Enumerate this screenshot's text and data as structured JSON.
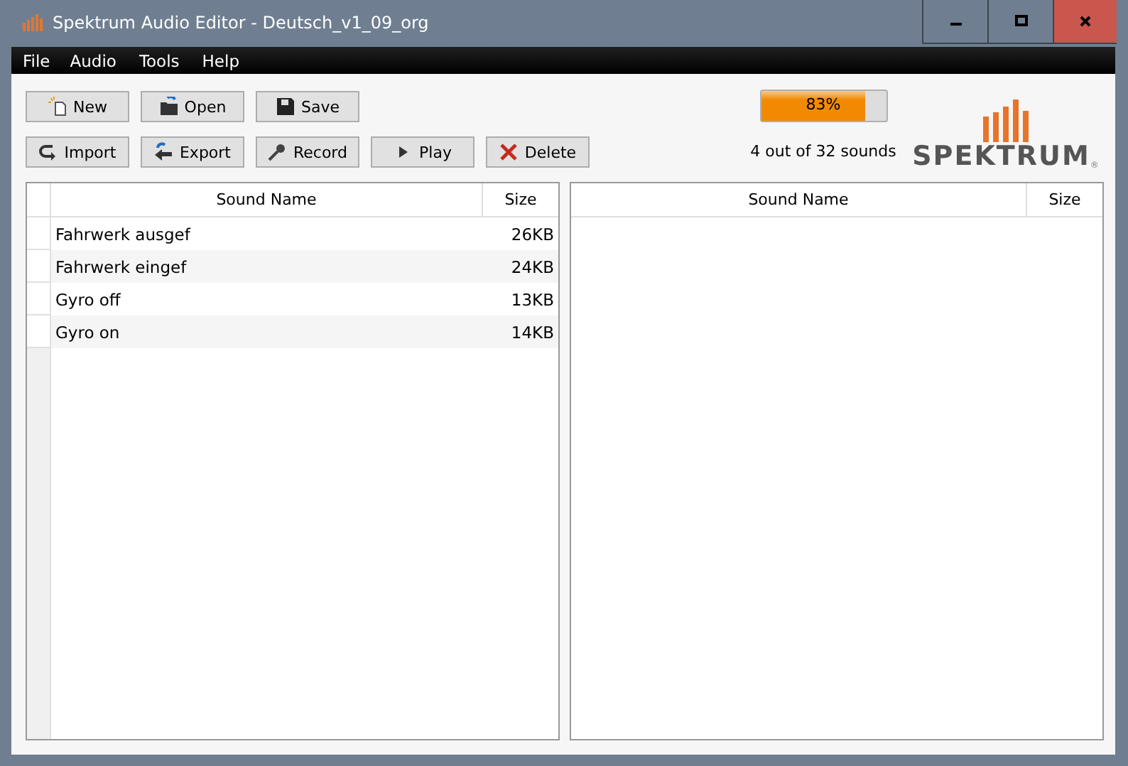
{
  "window": {
    "title": "Spektrum Audio Editor - Deutsch_v1_09_org"
  },
  "menu": [
    "File",
    "Audio",
    "Tools",
    "Help"
  ],
  "toolbar_rows": [
    [
      {
        "label": "New",
        "kind": "new"
      },
      {
        "label": "Open",
        "kind": "open"
      },
      {
        "label": "Save",
        "kind": "save"
      }
    ],
    [
      {
        "label": "Import",
        "kind": "import"
      },
      {
        "label": "Export",
        "kind": "export"
      },
      {
        "label": "Record",
        "kind": "record"
      },
      {
        "label": "Play",
        "kind": "play"
      },
      {
        "label": "Delete",
        "kind": "delete"
      }
    ]
  ],
  "progress": {
    "level": 0.83,
    "text": "83%"
  },
  "sound_count": "4 out of 32 sounds",
  "logo": {
    "text": "SPEKTRUM",
    "mark": "®"
  },
  "left_table": {
    "columns": [
      "Sound Name",
      "Size"
    ],
    "rows": [
      {
        "name": "Fahrwerk ausgef",
        "size": "26KB"
      },
      {
        "name": "Fahrwerk eingef",
        "size": "24KB"
      },
      {
        "name": "Gyro off",
        "size": "13KB"
      },
      {
        "name": "Gyro on",
        "size": "14KB"
      }
    ]
  },
  "right_table": {
    "columns": [
      "Sound Name",
      "Size"
    ]
  }
}
